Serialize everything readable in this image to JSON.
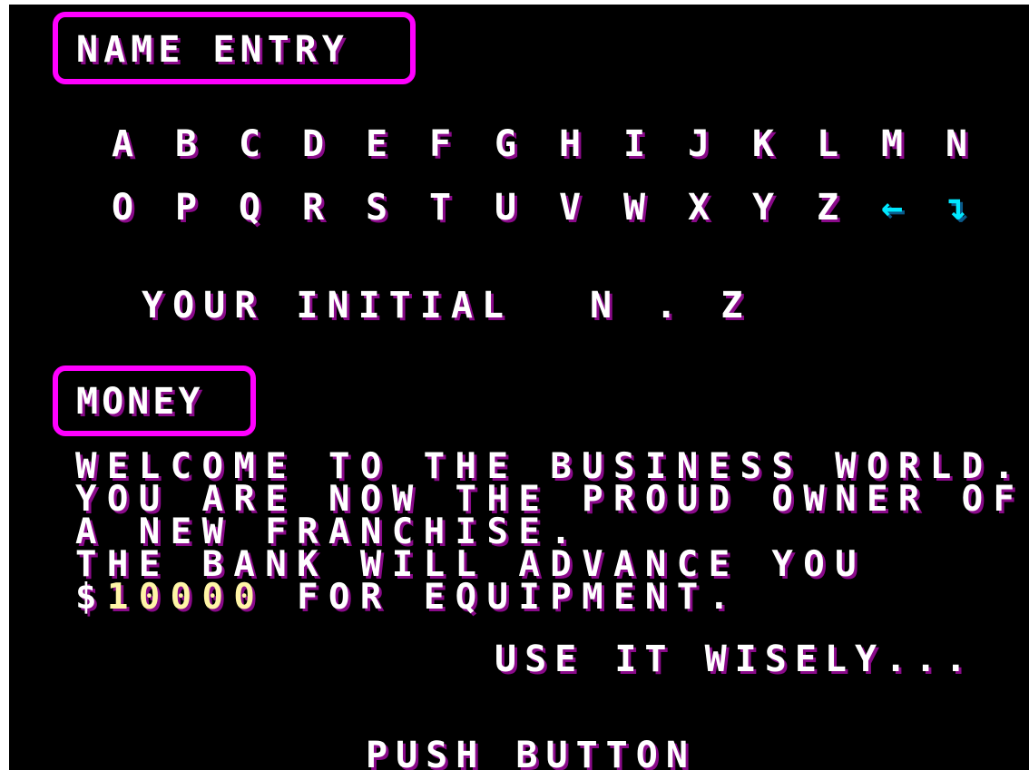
{
  "name_entry": {
    "title": "NAME ENTRY",
    "row1": [
      "A",
      "B",
      "C",
      "D",
      "E",
      "F",
      "G",
      "H",
      "I",
      "J",
      "K",
      "L",
      "M",
      "N"
    ],
    "row2": [
      "O",
      "P",
      "Q",
      "R",
      "S",
      "T",
      "U",
      "V",
      "W",
      "X",
      "Y",
      "Z"
    ],
    "backspace_glyph": "←",
    "end_glyph": "↴",
    "initial_label": "YOUR INITIAL",
    "initial_value": "N . Z"
  },
  "money": {
    "title": "MONEY",
    "line1": "WELCOME TO THE BUSINESS WORLD.",
    "line2": "YOU ARE NOW THE PROUD OWNER OF",
    "line3": "A NEW FRANCHISE.",
    "line4": "THE BANK WILL ADVANCE YOU",
    "currency": "$",
    "amount": "10000",
    "line5_rest": " FOR EQUIPMENT.",
    "advice": "USE IT WISELY...",
    "prompt": "PUSH BUTTON"
  },
  "colors": {
    "background": "#000000",
    "frame": "#ff00ff",
    "text": "#ffffff",
    "text_shadow": "#8a0a8a",
    "amount": "#fff5a6",
    "control_keys": "#00e8ff"
  }
}
